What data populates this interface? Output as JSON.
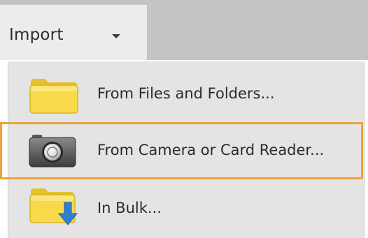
{
  "header": {
    "import_label": "Import"
  },
  "menu": {
    "items": [
      {
        "label": "From Files and Folders...",
        "icon": "folder-icon"
      },
      {
        "label": "From Camera or Card Reader...",
        "icon": "camera-icon",
        "highlighted": true
      },
      {
        "label": "In Bulk...",
        "icon": "folder-download-icon"
      }
    ]
  },
  "colors": {
    "toolbar_bg": "#c4c4c4",
    "tab_bg": "#ececec",
    "menu_bg": "#e4e4e4",
    "highlight_border": "#f0a33a",
    "folder_yellow": "#f7d94a",
    "arrow_blue": "#2f7fd8"
  }
}
